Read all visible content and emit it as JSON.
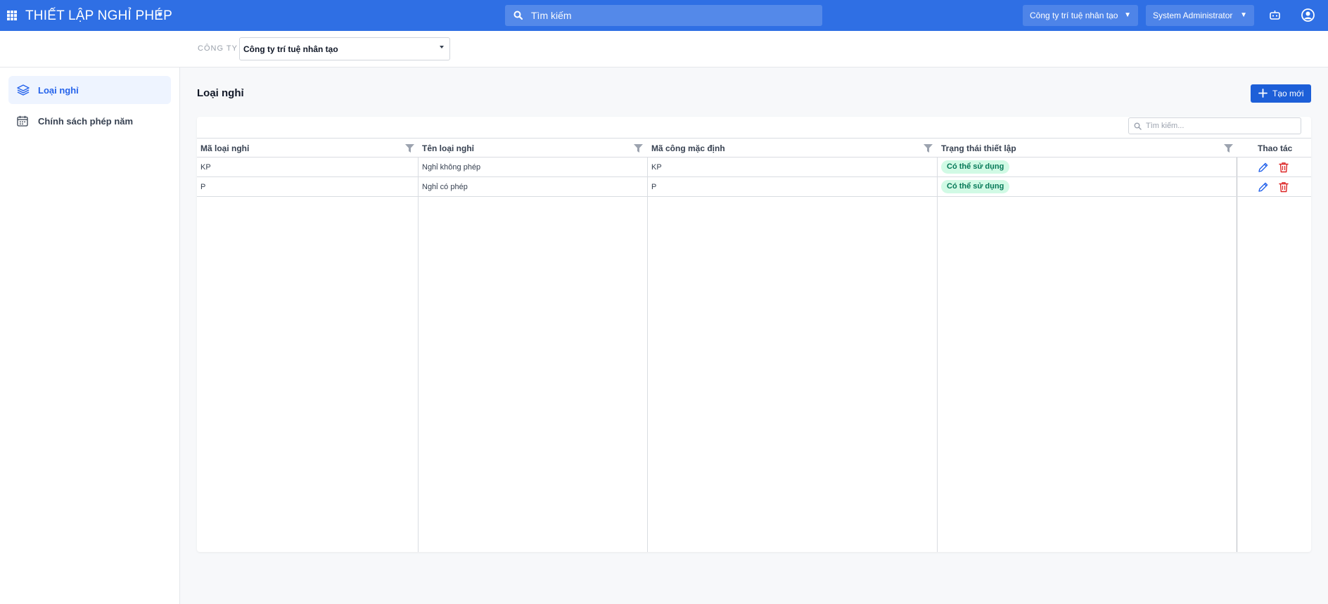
{
  "header": {
    "app_title": "THIẾT LẬP NGHỈ PHÉP",
    "search_placeholder": "Tìm kiếm",
    "company_switcher": "Công ty trí tuệ nhân tạo",
    "user_menu": "System Administrator",
    "brand_color": "#2f6fe4"
  },
  "company_bar": {
    "label": "CÔNG TY",
    "selected": "Công ty trí tuệ nhân tạo"
  },
  "sidebar": {
    "items": [
      {
        "label": "Loại nghỉ",
        "icon": "layers-icon",
        "active": true
      },
      {
        "label": "Chính sách phép năm",
        "icon": "calendar-icon",
        "active": false
      }
    ]
  },
  "main": {
    "title": "Loại nghỉ",
    "create_label": "Tạo mới",
    "table_search_placeholder": "Tìm kiếm...",
    "columns": [
      "Mã loại nghỉ",
      "Tên loại nghỉ",
      "Mã công mặc định",
      "Trạng thái thiết lập",
      "Thao tác"
    ],
    "rows": [
      {
        "code": "KP",
        "name": "Nghỉ không phép",
        "default_code": "KP",
        "status": "Có thể sử dụng"
      },
      {
        "code": "P",
        "name": "Nghỉ có phép",
        "default_code": "P",
        "status": "Có thể sử dụng"
      }
    ],
    "status_color": "#047857",
    "edit_color": "#2563eb",
    "delete_color": "#dc2626"
  }
}
